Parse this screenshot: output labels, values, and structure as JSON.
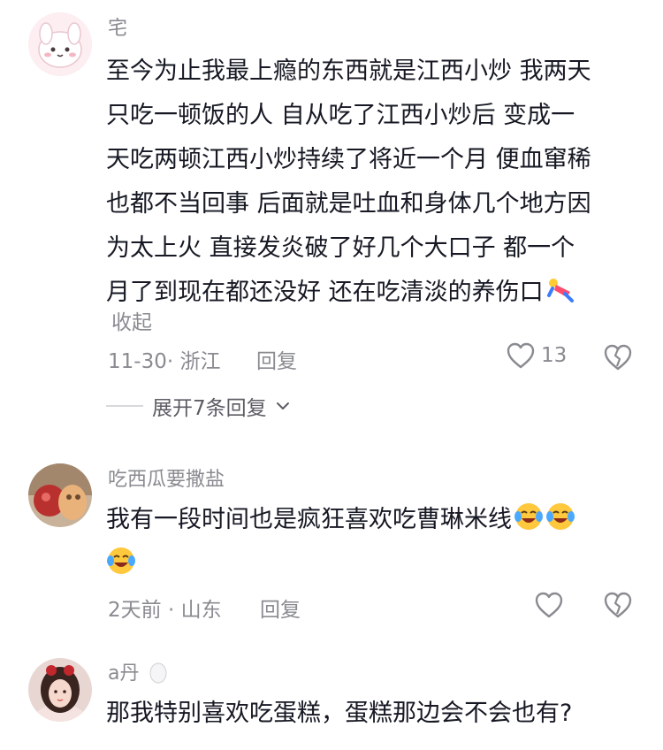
{
  "comments": [
    {
      "username": "宅",
      "lines": [
        "至今为止我最上瘾的东西就是江西小炒 我两天",
        "只吃一顿饭的人 自从吃了江西小炒后 变成一",
        "天吃两顿江西小炒持续了将近一个月 便血窜稀",
        "也都不当回事 后面就是吐血和身体几个地方因",
        "为太上火 直接发炎破了好几个大口子 都一个",
        "月了到现在都还没好 还在吃清淡的养伤口"
      ],
      "collapse_label": "收起",
      "meta": "11-30· 浙江",
      "reply_label": "回复",
      "like_count": "13",
      "expand_label": "展开7条回复"
    },
    {
      "username": "吃西瓜要撒盐",
      "lines": [
        "我有一段时间也是疯狂喜欢吃曹琳米线"
      ],
      "meta": "2天前 · 山东",
      "reply_label": "回复"
    },
    {
      "username": "a丹",
      "lines": [
        "那我特别喜欢吃蛋糕，蛋糕那边会不会也有?"
      ]
    }
  ],
  "icons": {
    "like": "heart-outline-icon",
    "dislike": "broken-heart-icon",
    "expand": "chevron-down-icon",
    "emoji_laugh": "laughing-crying-emoji",
    "emoji_fall": "falling-person-emoji",
    "egg": "egg-icon"
  },
  "colors": {
    "text": "#161823",
    "meta": "#8a8b91"
  }
}
